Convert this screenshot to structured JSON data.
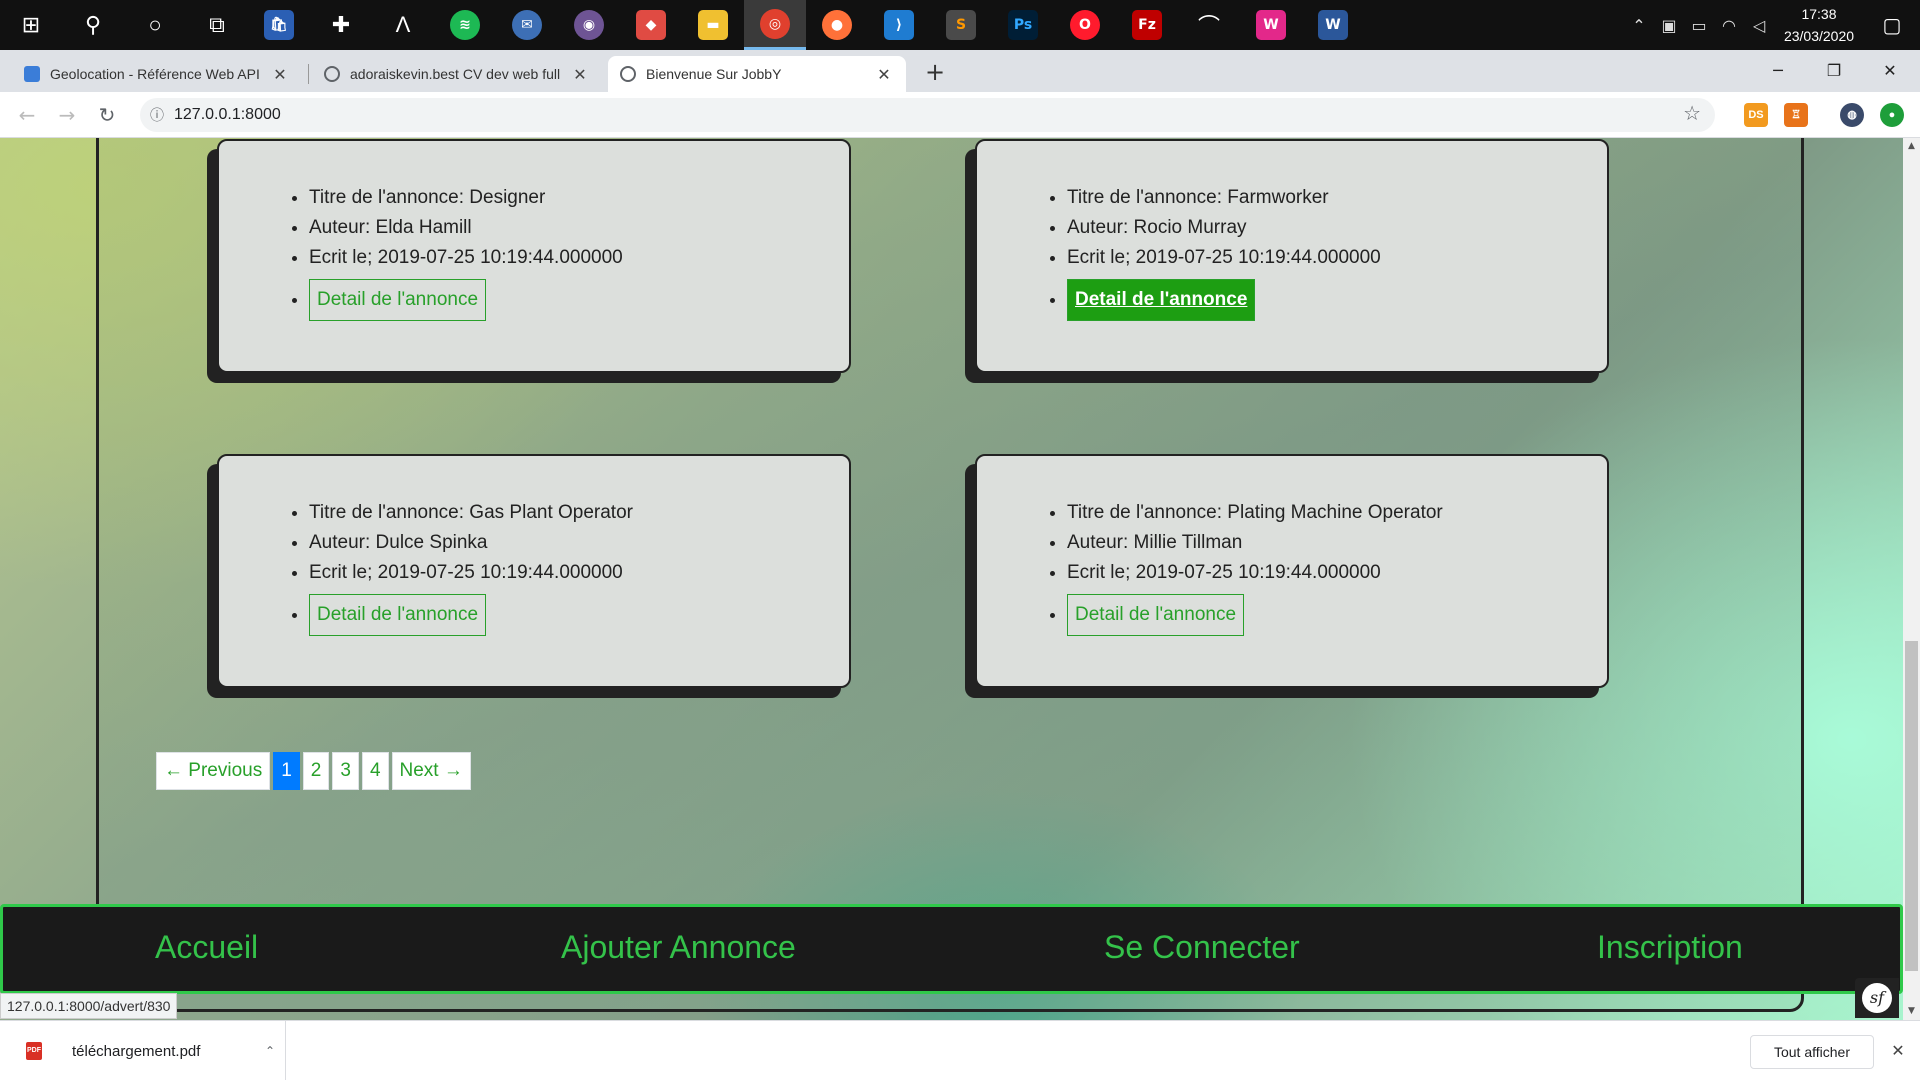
{
  "taskbar": {
    "apps": [
      {
        "icon": "windows-start-icon",
        "glyph": "⊞"
      },
      {
        "icon": "search-icon",
        "glyph": "⚲"
      },
      {
        "icon": "cortana-icon",
        "glyph": "○"
      },
      {
        "icon": "task-view-icon",
        "glyph": "⧉"
      },
      {
        "icon": "store-icon",
        "glyph": "🛍"
      },
      {
        "icon": "plus-app-icon",
        "glyph": "✚"
      },
      {
        "icon": "lambda-app-icon",
        "glyph": "Λ"
      },
      {
        "icon": "spotify-icon",
        "glyph": "≋"
      },
      {
        "icon": "thunderbird-icon",
        "glyph": "✉"
      },
      {
        "icon": "github-icon",
        "glyph": "◉"
      },
      {
        "icon": "git-app-icon",
        "glyph": "◆"
      },
      {
        "icon": "file-explorer-icon",
        "glyph": "▬"
      },
      {
        "icon": "chrome-icon",
        "glyph": "◎"
      },
      {
        "icon": "firefox-icon",
        "glyph": "●"
      },
      {
        "icon": "vscode-icon",
        "glyph": "⟩"
      },
      {
        "icon": "sublime-icon",
        "glyph": "S"
      },
      {
        "icon": "photoshop-icon",
        "glyph": "Ps"
      },
      {
        "icon": "opera-icon",
        "glyph": "O"
      },
      {
        "icon": "filezilla-icon",
        "glyph": "Fz"
      },
      {
        "icon": "feather-app-icon",
        "glyph": "⌒"
      },
      {
        "icon": "wamp-icon",
        "glyph": "W"
      },
      {
        "icon": "word-icon",
        "glyph": "W"
      }
    ],
    "time": "17:38",
    "date": "23/03/2020"
  },
  "tabs": [
    {
      "title": "Geolocation - Référence Web API",
      "close": "✕"
    },
    {
      "title": "adoraiskevin.best CV dev web full",
      "close": "✕"
    },
    {
      "title": "Bienvenue Sur JobbY",
      "close": "✕"
    }
  ],
  "new_tab": "+",
  "window_controls": {
    "minimize": "─",
    "restore": "❐",
    "close": "✕"
  },
  "nav": {
    "back": "←",
    "forward": "→",
    "reload": "↻"
  },
  "address_bar": {
    "info": "ⓘ",
    "url": "127.0.0.1:8000",
    "star": "☆"
  },
  "extensions": [
    {
      "label": "DS",
      "color": "#f29a1f"
    },
    {
      "label": "♖",
      "color": "#e8731a"
    },
    {
      "label": "◍",
      "color": "#3a4a6a"
    },
    {
      "label": "●",
      "color": "#1e9e3a"
    }
  ],
  "adverts": [
    {
      "title": "Titre de l'annonce: Designer",
      "author": "Auteur: Elda Hamill",
      "date": "Ecrit le; 2019-07-25 10:19:44.000000",
      "button": "Detail de l'annonce"
    },
    {
      "title": "Titre de l'annonce: Farmworker",
      "author": "Auteur: Rocio Murray",
      "date": "Ecrit le; 2019-07-25 10:19:44.000000",
      "button": "Detail de l'annonce"
    },
    {
      "title": "Titre de l'annonce: Gas Plant Operator",
      "author": "Auteur: Dulce Spinka",
      "date": "Ecrit le; 2019-07-25 10:19:44.000000",
      "button": "Detail de l'annonce"
    },
    {
      "title": "Titre de l'annonce: Plating Machine Operator",
      "author": "Auteur: Millie Tillman",
      "date": "Ecrit le; 2019-07-25 10:19:44.000000",
      "button": "Detail de l'annonce"
    }
  ],
  "pagination": {
    "previous": "← Previous",
    "pages": [
      "1",
      "2",
      "3",
      "4"
    ],
    "current": "1",
    "next": "Next →"
  },
  "footer": {
    "home": "Accueil",
    "add": "Ajouter Annonce",
    "login": "Se Connecter",
    "signup": "Inscription"
  },
  "status_url": "127.0.0.1:8000/advert/830",
  "symfony_toolbar": "sf",
  "scrollbar": {
    "up": "▲",
    "down": "▼"
  },
  "download": {
    "file_name": "téléchargement.pdf",
    "pdf_label": "PDF",
    "chevron": "⌃",
    "show_all": "Tout afficher",
    "close": "✕"
  },
  "colors": {
    "accent_green": "#28a02a",
    "hover_green": "#1d9e12",
    "active_page": "#007bff",
    "footer_border": "#2fc94a"
  }
}
